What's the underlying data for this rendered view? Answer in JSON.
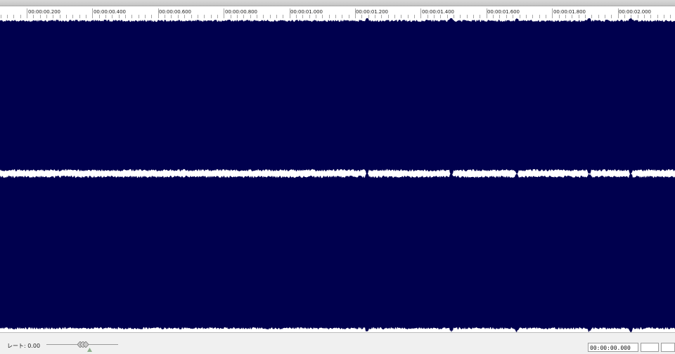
{
  "ruler": {
    "ticks": [
      {
        "label": "00:00:00.200"
      },
      {
        "label": "00:00:00.400"
      },
      {
        "label": "00:00:00.600"
      },
      {
        "label": "00:00:00.800"
      },
      {
        "label": "00:00:01.000"
      },
      {
        "label": "00:00:01.200"
      },
      {
        "label": "00:00:01.400"
      },
      {
        "label": "00:00:01.600"
      },
      {
        "label": "00:00:01.800"
      },
      {
        "label": "00:00:02.000"
      }
    ]
  },
  "waveform": {
    "channel_count": 2,
    "fill_color": "#00004e",
    "background_color": "#ffffff"
  },
  "status": {
    "rate_label": "レート: 0.00",
    "rate_value": 0.0,
    "time_display": "00:00:00.000",
    "time_display_secondary": ""
  },
  "colors": {
    "accent": "#8fb08c"
  }
}
